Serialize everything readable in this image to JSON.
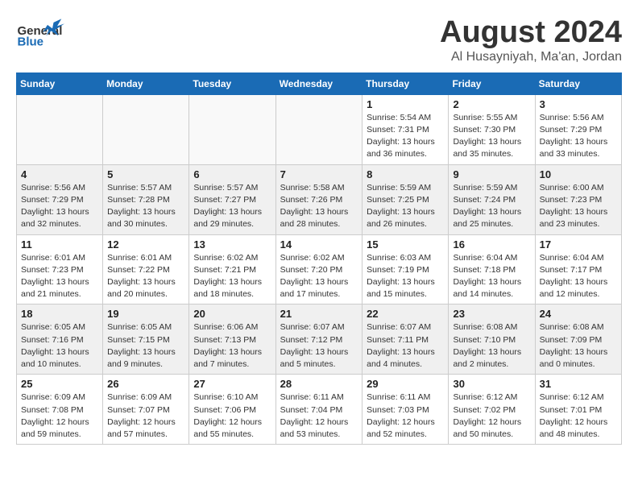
{
  "header": {
    "logo_general": "General",
    "logo_blue": "Blue",
    "month": "August 2024",
    "location": "Al Husayniyah, Ma'an, Jordan"
  },
  "weekdays": [
    "Sunday",
    "Monday",
    "Tuesday",
    "Wednesday",
    "Thursday",
    "Friday",
    "Saturday"
  ],
  "weeks": [
    [
      {
        "day": "",
        "info": ""
      },
      {
        "day": "",
        "info": ""
      },
      {
        "day": "",
        "info": ""
      },
      {
        "day": "",
        "info": ""
      },
      {
        "day": "1",
        "info": "Sunrise: 5:54 AM\nSunset: 7:31 PM\nDaylight: 13 hours\nand 36 minutes."
      },
      {
        "day": "2",
        "info": "Sunrise: 5:55 AM\nSunset: 7:30 PM\nDaylight: 13 hours\nand 35 minutes."
      },
      {
        "day": "3",
        "info": "Sunrise: 5:56 AM\nSunset: 7:29 PM\nDaylight: 13 hours\nand 33 minutes."
      }
    ],
    [
      {
        "day": "4",
        "info": "Sunrise: 5:56 AM\nSunset: 7:29 PM\nDaylight: 13 hours\nand 32 minutes."
      },
      {
        "day": "5",
        "info": "Sunrise: 5:57 AM\nSunset: 7:28 PM\nDaylight: 13 hours\nand 30 minutes."
      },
      {
        "day": "6",
        "info": "Sunrise: 5:57 AM\nSunset: 7:27 PM\nDaylight: 13 hours\nand 29 minutes."
      },
      {
        "day": "7",
        "info": "Sunrise: 5:58 AM\nSunset: 7:26 PM\nDaylight: 13 hours\nand 28 minutes."
      },
      {
        "day": "8",
        "info": "Sunrise: 5:59 AM\nSunset: 7:25 PM\nDaylight: 13 hours\nand 26 minutes."
      },
      {
        "day": "9",
        "info": "Sunrise: 5:59 AM\nSunset: 7:24 PM\nDaylight: 13 hours\nand 25 minutes."
      },
      {
        "day": "10",
        "info": "Sunrise: 6:00 AM\nSunset: 7:23 PM\nDaylight: 13 hours\nand 23 minutes."
      }
    ],
    [
      {
        "day": "11",
        "info": "Sunrise: 6:01 AM\nSunset: 7:23 PM\nDaylight: 13 hours\nand 21 minutes."
      },
      {
        "day": "12",
        "info": "Sunrise: 6:01 AM\nSunset: 7:22 PM\nDaylight: 13 hours\nand 20 minutes."
      },
      {
        "day": "13",
        "info": "Sunrise: 6:02 AM\nSunset: 7:21 PM\nDaylight: 13 hours\nand 18 minutes."
      },
      {
        "day": "14",
        "info": "Sunrise: 6:02 AM\nSunset: 7:20 PM\nDaylight: 13 hours\nand 17 minutes."
      },
      {
        "day": "15",
        "info": "Sunrise: 6:03 AM\nSunset: 7:19 PM\nDaylight: 13 hours\nand 15 minutes."
      },
      {
        "day": "16",
        "info": "Sunrise: 6:04 AM\nSunset: 7:18 PM\nDaylight: 13 hours\nand 14 minutes."
      },
      {
        "day": "17",
        "info": "Sunrise: 6:04 AM\nSunset: 7:17 PM\nDaylight: 13 hours\nand 12 minutes."
      }
    ],
    [
      {
        "day": "18",
        "info": "Sunrise: 6:05 AM\nSunset: 7:16 PM\nDaylight: 13 hours\nand 10 minutes."
      },
      {
        "day": "19",
        "info": "Sunrise: 6:05 AM\nSunset: 7:15 PM\nDaylight: 13 hours\nand 9 minutes."
      },
      {
        "day": "20",
        "info": "Sunrise: 6:06 AM\nSunset: 7:13 PM\nDaylight: 13 hours\nand 7 minutes."
      },
      {
        "day": "21",
        "info": "Sunrise: 6:07 AM\nSunset: 7:12 PM\nDaylight: 13 hours\nand 5 minutes."
      },
      {
        "day": "22",
        "info": "Sunrise: 6:07 AM\nSunset: 7:11 PM\nDaylight: 13 hours\nand 4 minutes."
      },
      {
        "day": "23",
        "info": "Sunrise: 6:08 AM\nSunset: 7:10 PM\nDaylight: 13 hours\nand 2 minutes."
      },
      {
        "day": "24",
        "info": "Sunrise: 6:08 AM\nSunset: 7:09 PM\nDaylight: 13 hours\nand 0 minutes."
      }
    ],
    [
      {
        "day": "25",
        "info": "Sunrise: 6:09 AM\nSunset: 7:08 PM\nDaylight: 12 hours\nand 59 minutes."
      },
      {
        "day": "26",
        "info": "Sunrise: 6:09 AM\nSunset: 7:07 PM\nDaylight: 12 hours\nand 57 minutes."
      },
      {
        "day": "27",
        "info": "Sunrise: 6:10 AM\nSunset: 7:06 PM\nDaylight: 12 hours\nand 55 minutes."
      },
      {
        "day": "28",
        "info": "Sunrise: 6:11 AM\nSunset: 7:04 PM\nDaylight: 12 hours\nand 53 minutes."
      },
      {
        "day": "29",
        "info": "Sunrise: 6:11 AM\nSunset: 7:03 PM\nDaylight: 12 hours\nand 52 minutes."
      },
      {
        "day": "30",
        "info": "Sunrise: 6:12 AM\nSunset: 7:02 PM\nDaylight: 12 hours\nand 50 minutes."
      },
      {
        "day": "31",
        "info": "Sunrise: 6:12 AM\nSunset: 7:01 PM\nDaylight: 12 hours\nand 48 minutes."
      }
    ]
  ]
}
